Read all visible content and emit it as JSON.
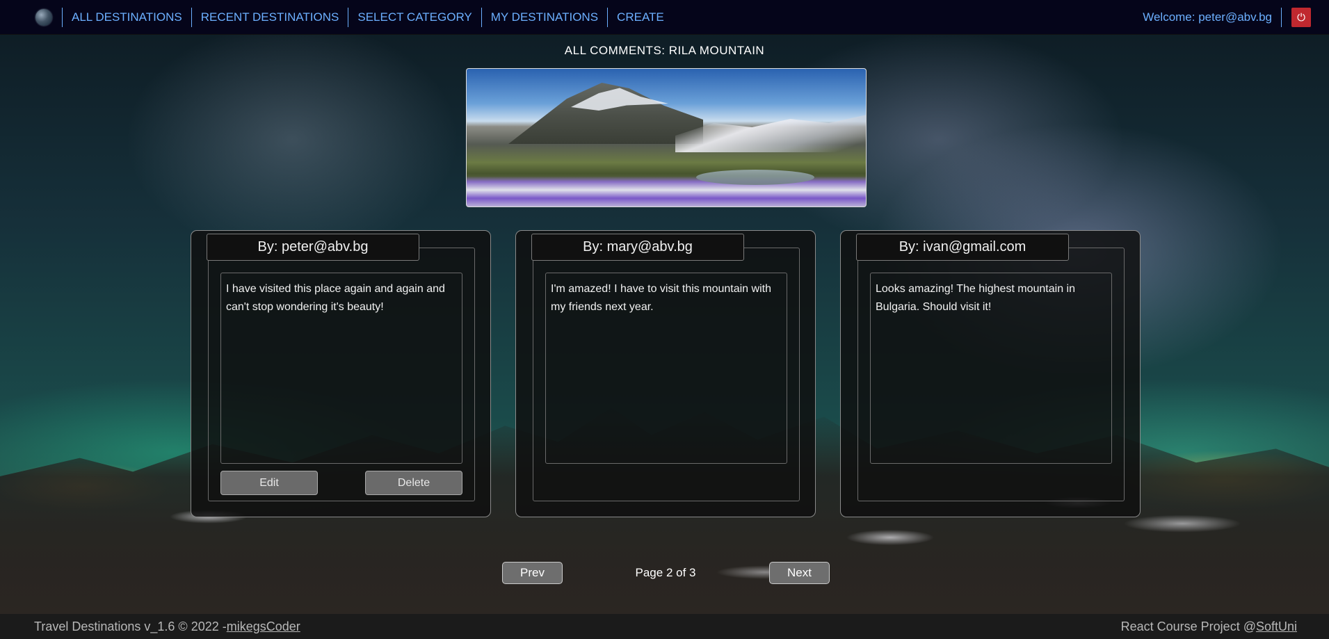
{
  "nav": {
    "items": [
      {
        "label": "ALL DESTINATIONS"
      },
      {
        "label": "RECENT DESTINATIONS"
      },
      {
        "label": "SELECT CATEGORY"
      },
      {
        "label": "MY DESTINATIONS"
      },
      {
        "label": "CREATE"
      }
    ],
    "welcome": "Welcome: peter@abv.bg",
    "logout_icon": "power-icon"
  },
  "page": {
    "title": "ALL COMMENTS: RILA MOUNTAIN"
  },
  "comments": [
    {
      "author": "By: peter@abv.bg",
      "text": "I have visited this place again and again and can't stop wondering it's beauty!",
      "edit_label": "Edit",
      "delete_label": "Delete"
    },
    {
      "author": "By: mary@abv.bg",
      "text": "I'm amazed! I have to visit this mountain with my friends next year."
    },
    {
      "author": "By: ivan@gmail.com",
      "text": "Looks amazing! The highest mountain in Bulgaria. Should visit it!"
    }
  ],
  "pagination": {
    "prev_label": "Prev",
    "next_label": "Next",
    "page_label": "Page 2 of 3"
  },
  "footer": {
    "left_text": "Travel Destinations v_1.6 © 2022 -",
    "left_link": "mikegsCoder",
    "right_text": "React Course Project @",
    "right_link": "SoftUni"
  },
  "colors": {
    "nav_bg": "#05051a",
    "nav_link": "#6cb0ff",
    "logout": "#c0282f"
  }
}
